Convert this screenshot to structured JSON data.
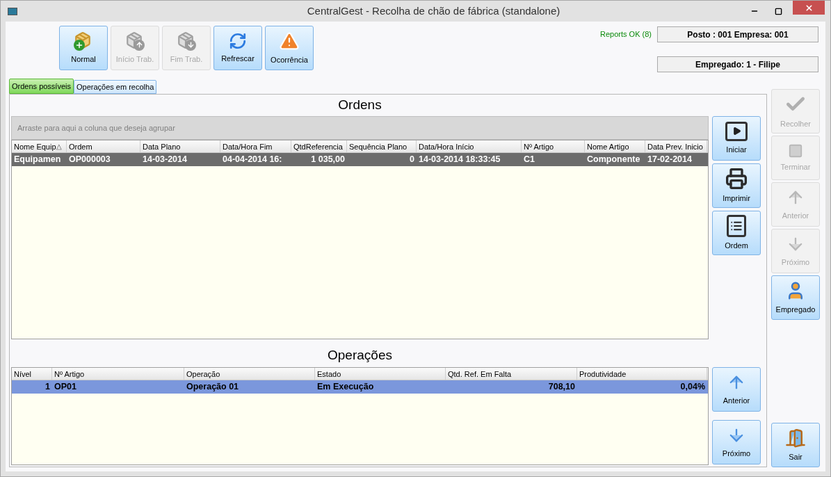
{
  "window": {
    "title": "CentralGest - Recolha de chão de fábrica (standalone)"
  },
  "toolbar": [
    {
      "label": "Normal",
      "kind": "add-boxes",
      "disabled": false
    },
    {
      "label": "Início Trab.",
      "kind": "boxes-up",
      "disabled": true
    },
    {
      "label": "Fim Trab.",
      "kind": "boxes-down",
      "disabled": true
    },
    {
      "label": "Refrescar",
      "kind": "refresh",
      "disabled": false
    },
    {
      "label": "Ocorrência",
      "kind": "warning",
      "disabled": false
    }
  ],
  "status": {
    "reports": "Reports OK (8)",
    "station": "Posto : 001 Empresa: 001",
    "employee": "Empregado: 1 - Filipe"
  },
  "tabs": [
    {
      "label": "Ordens possíveis",
      "selected": true
    },
    {
      "label": "Operações em recolha",
      "selected": false
    }
  ],
  "orders": {
    "title": "Ordens",
    "group_hint": "Arraste para aqui a coluna que deseja agrupar",
    "columns": [
      {
        "label": "Nome Equip",
        "sort": "△",
        "numeric": false
      },
      {
        "label": "Ordem",
        "numeric": false
      },
      {
        "label": "Data Plano",
        "numeric": false
      },
      {
        "label": "Data/Hora Fim",
        "numeric": false
      },
      {
        "label": "QtdReferencia",
        "numeric": true
      },
      {
        "label": "Sequência Plano",
        "numeric": true
      },
      {
        "label": "Data/Hora Início",
        "numeric": false
      },
      {
        "label": "Nº Artigo",
        "numeric": false
      },
      {
        "label": "Nome Artigo",
        "numeric": false
      },
      {
        "label": "Data Prev. Inicio",
        "numeric": false
      }
    ],
    "rows": [
      {
        "selected": true,
        "cells": [
          "Equipamen",
          "OP000003",
          "14-03-2014",
          "04-04-2014 16:",
          "1 035,00",
          "0",
          "14-03-2014 18:33:45",
          "C1",
          "Componente",
          "17-02-2014"
        ]
      }
    ]
  },
  "order_actions": [
    {
      "label": "Iniciar",
      "kind": "play"
    },
    {
      "label": "Imprimir",
      "kind": "print"
    },
    {
      "label": "Ordem",
      "kind": "list"
    }
  ],
  "operations": {
    "title": "Operações",
    "columns": [
      {
        "label": "Nível",
        "numeric": true
      },
      {
        "label": "Nº Artigo",
        "numeric": false
      },
      {
        "label": "Operação",
        "numeric": false
      },
      {
        "label": "Estado",
        "numeric": false
      },
      {
        "label": "Qtd. Ref. Em Falta",
        "numeric": true
      },
      {
        "label": "Produtividade",
        "numeric": true
      }
    ],
    "rows": [
      {
        "selected": true,
        "cells": [
          "1",
          "OP01",
          "Operação 01",
          "Em Execução",
          "708,10",
          "0,04%"
        ]
      }
    ]
  },
  "operation_nav": [
    {
      "label": "Anterior",
      "kind": "up"
    },
    {
      "label": "Próximo",
      "kind": "down"
    }
  ],
  "side_actions": [
    {
      "label": "Recolher",
      "kind": "check",
      "disabled": true
    },
    {
      "label": "Terminar",
      "kind": "stop",
      "disabled": true
    },
    {
      "label": "Anterior",
      "kind": "up",
      "disabled": true
    },
    {
      "label": "Próximo",
      "kind": "down",
      "disabled": true
    },
    {
      "label": "Empregado",
      "kind": "worker",
      "disabled": false
    }
  ],
  "exit": {
    "label": "Sair",
    "kind": "door"
  }
}
